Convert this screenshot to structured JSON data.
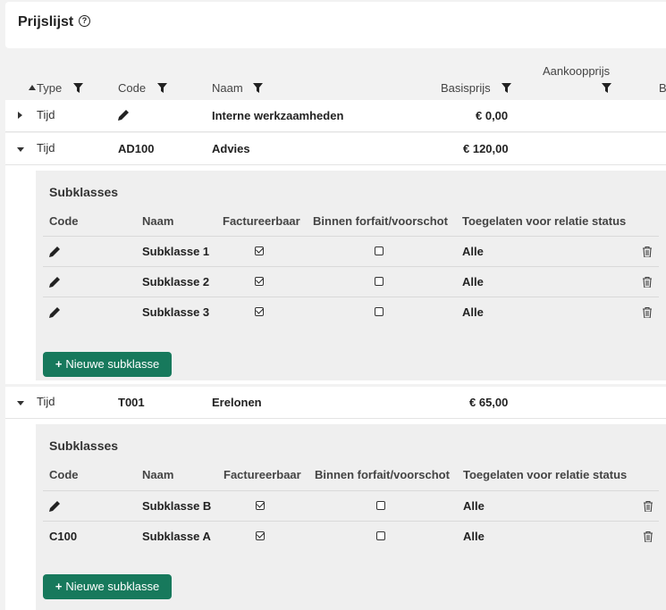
{
  "page": {
    "title": "Prijslijst",
    "help_icon": "question-circle-icon"
  },
  "columns": {
    "type": "Type",
    "code": "Code",
    "naam": "Naam",
    "basisprijs": "Basisprijs",
    "aankoopprijs": "Aankoopprijs",
    "overflow": "B"
  },
  "rows": [
    {
      "type": "Tijd",
      "code": "",
      "naam": "Interne werkzaamheden",
      "basisprijs": "€ 0,00",
      "expanded": false
    },
    {
      "type": "Tijd",
      "code": "AD100",
      "naam": "Advies",
      "basisprijs": "€ 120,00",
      "expanded": true
    },
    {
      "type": "Tijd",
      "code": "T001",
      "naam": "Erelonen",
      "basisprijs": "€ 65,00",
      "expanded": true
    }
  ],
  "subpanels": [
    {
      "title": "Subklasses",
      "headers": {
        "code": "Code",
        "naam": "Naam",
        "factureerbaar": "Factureerbaar",
        "forfait": "Binnen forfait/voorschot",
        "status": "Toegelaten voor relatie status"
      },
      "items": [
        {
          "code": "",
          "naam": "Subklasse 1",
          "factureerbaar": true,
          "forfait": false,
          "status": "Alle"
        },
        {
          "code": "",
          "naam": "Subklasse 2",
          "factureerbaar": true,
          "forfait": false,
          "status": "Alle"
        },
        {
          "code": "",
          "naam": "Subklasse 3",
          "factureerbaar": true,
          "forfait": false,
          "status": "Alle"
        }
      ],
      "button": "Nieuwe subklasse"
    },
    {
      "title": "Subklasses",
      "headers": {
        "code": "Code",
        "naam": "Naam",
        "factureerbaar": "Factureerbaar",
        "forfait": "Binnen forfait/voorschot",
        "status": "Toegelaten voor relatie status"
      },
      "items": [
        {
          "code": "",
          "naam": "Subklasse B",
          "factureerbaar": true,
          "forfait": false,
          "status": "Alle"
        },
        {
          "code": "C100",
          "naam": "Subklasse A",
          "factureerbaar": true,
          "forfait": false,
          "status": "Alle"
        }
      ],
      "button": "Nieuwe subklasse"
    }
  ]
}
